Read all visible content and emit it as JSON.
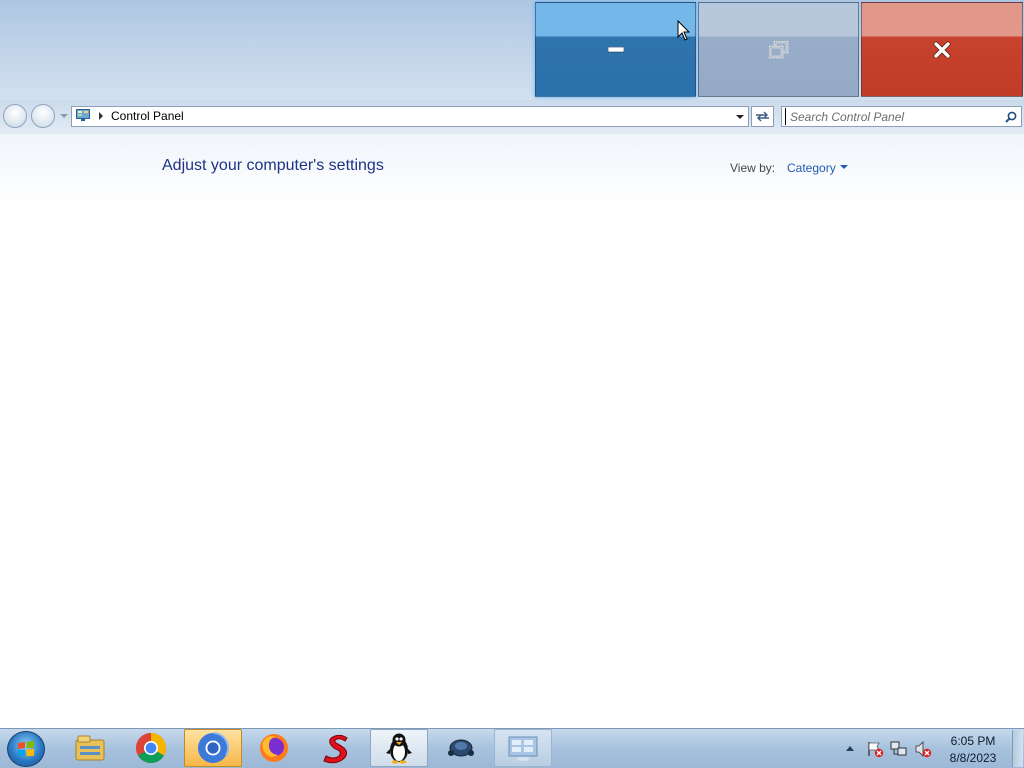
{
  "window": {
    "buttons": {
      "minimize": "minimize-icon",
      "restore": "restore-icon",
      "close": "close-icon"
    }
  },
  "address_bar": {
    "breadcrumb": "Control Panel",
    "search_placeholder": "Search Control Panel"
  },
  "main": {
    "title": "Adjust your computer's settings",
    "view_by_label": "View by:",
    "view_by_value": "Category"
  },
  "taskbar": {
    "items": [
      "file-explorer-icon",
      "chrome-icon",
      "chrome-icon",
      "firefox-icon",
      "s-app-icon",
      "penguin-icon",
      "mouse-app-icon",
      "control-panel-icon"
    ],
    "clock_time": "6:05 PM",
    "clock_date": "8/8/2023"
  },
  "colors": {
    "minimize_hover": "#2f74ad",
    "close": "#c7432e",
    "title_text": "#1e3287",
    "link_blue": "#1e5cb3"
  }
}
